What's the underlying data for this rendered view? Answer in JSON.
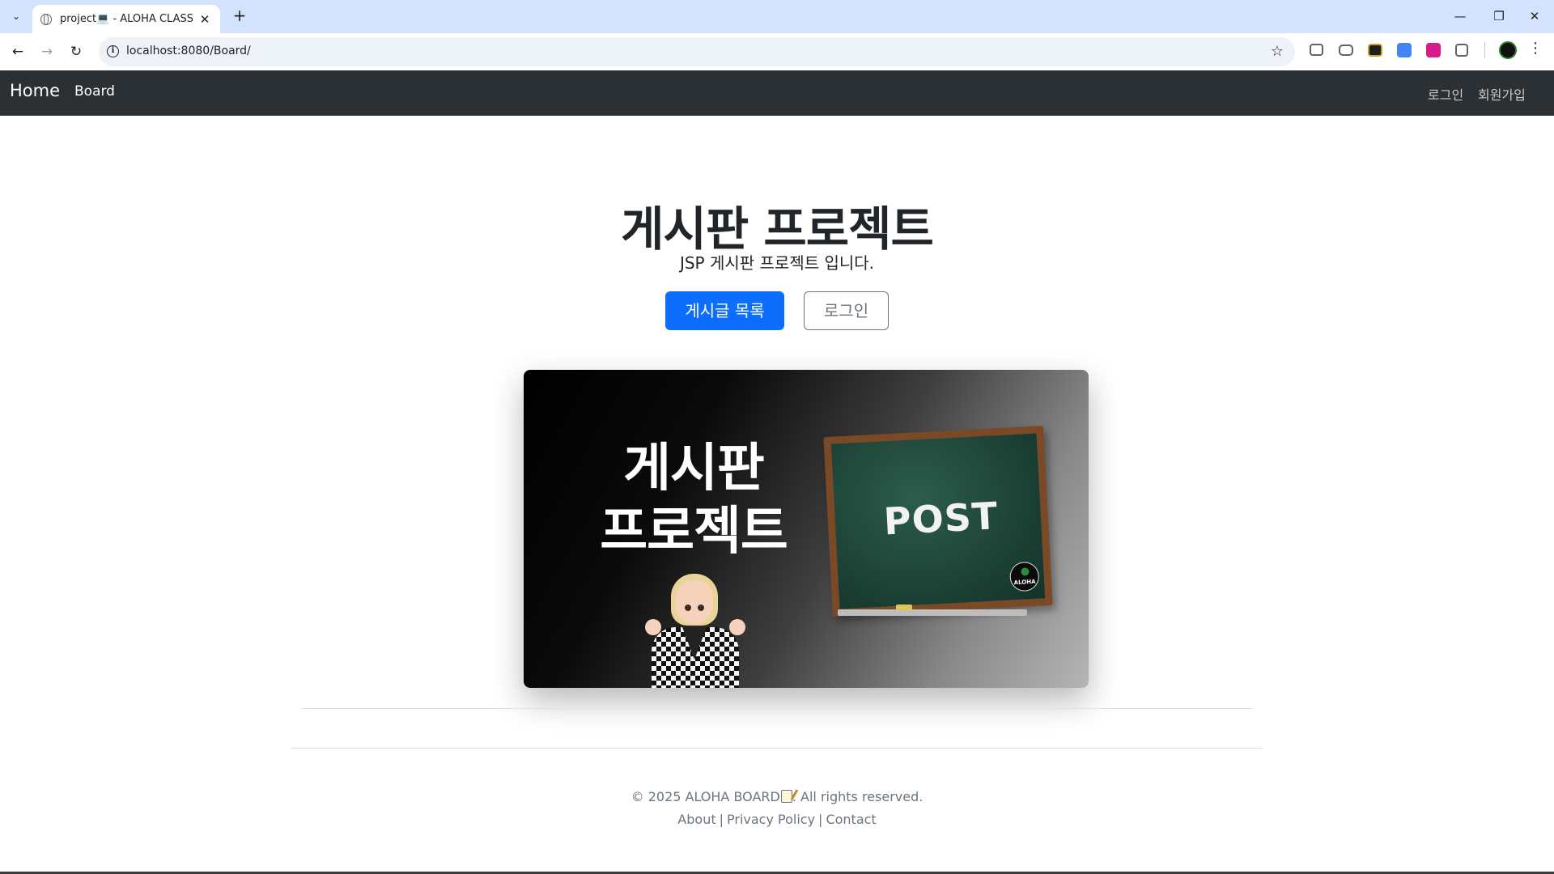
{
  "browser": {
    "tab_title": "project💻 - ALOHA CLASS🌴",
    "url": "localhost:8080/Board/",
    "icons": [
      "tab-search-icon",
      "globe-icon",
      "close-icon",
      "plus-icon",
      "back-arrow-icon",
      "forward-arrow-icon",
      "reload-icon",
      "info-icon",
      "star-icon",
      "extensions-icon",
      "kebab-menu-icon"
    ]
  },
  "navbar": {
    "brand": "Home",
    "board": "Board",
    "login": "로그인",
    "signup": "회원가입"
  },
  "hero": {
    "title": "게시판 프로젝트",
    "subtitle": "JSP 게시판 프로젝트 입니다.",
    "primary_button": "게시글 목록",
    "secondary_button": "로그인"
  },
  "banner": {
    "line1": "게시판",
    "line2": "프로젝트",
    "board_text": "POST",
    "logo_text": "ALOHA"
  },
  "footer": {
    "copyright_prefix": "© 2025 ALOHA BOARD",
    "copyright_suffix": ". All rights reserved.",
    "links": {
      "about": "About",
      "privacy": "Privacy Policy",
      "contact": "Contact"
    },
    "separator": "|"
  },
  "colors": {
    "primary": "#0d6efd",
    "navbar_bg": "#2b3035",
    "tabstrip_bg": "#d3e3fd"
  }
}
